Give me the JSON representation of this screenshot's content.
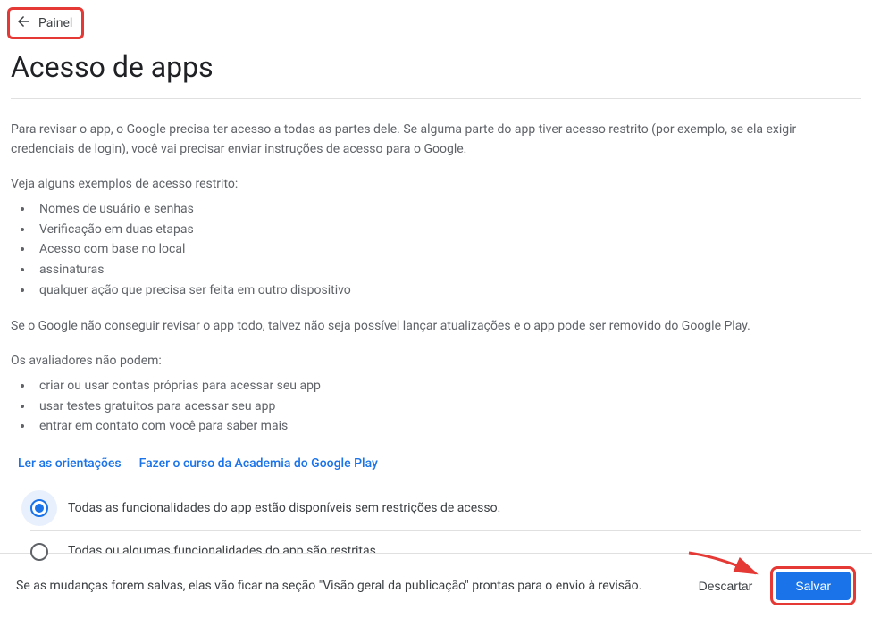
{
  "nav": {
    "back_label": "Painel"
  },
  "page": {
    "title": "Acesso de apps"
  },
  "intro": {
    "paragraph": "Para revisar o app, o Google precisa ter acesso a todas as partes dele. Se alguma parte do app tiver acesso restrito (por exemplo, se ela exigir credenciais de login), você vai precisar enviar instruções de acesso para o Google."
  },
  "examples": {
    "label": "Veja alguns exemplos de acesso restrito:",
    "items": [
      "Nomes de usuário e senhas",
      "Verificação em duas etapas",
      "Acesso com base no local",
      "assinaturas",
      "qualquer ação que precisa ser feita em outro dispositivo"
    ]
  },
  "warning": "Se o Google não conseguir revisar o app todo, talvez não seja possível lançar atualizações e o app pode ser removido do Google Play.",
  "reviewers": {
    "label": "Os avaliadores não podem:",
    "items": [
      "criar ou usar contas próprias para acessar seu app",
      "usar testes gratuitos para acessar seu app",
      "entrar em contato com você para saber mais"
    ]
  },
  "links": {
    "guidelines": "Ler as orientações",
    "academy": "Fazer o curso da Academia do Google Play"
  },
  "options": {
    "unrestricted": "Todas as funcionalidades do app estão disponíveis sem restrições de acesso.",
    "restricted": "Todas ou algumas funcionalidades do app são restritas."
  },
  "footer": {
    "message": "Se as mudanças forem salvas, elas vão ficar na seção \"Visão geral da publicação\" prontas para o envio à revisão.",
    "discard": "Descartar",
    "save": "Salvar"
  }
}
